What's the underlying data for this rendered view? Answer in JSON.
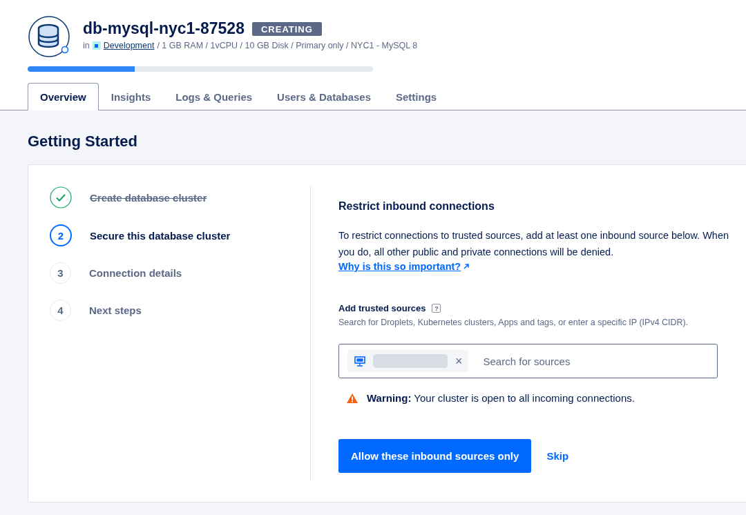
{
  "header": {
    "title": "db-mysql-nyc1-87528",
    "status": "CREATING",
    "meta_prefix": "in",
    "project": "Development",
    "meta": "/ 1 GB RAM / 1vCPU / 10 GB Disk / Primary only / NYC1 - MySQL 8",
    "progress": {
      "level": 0.31
    }
  },
  "tabs": [
    {
      "label": "Overview",
      "selected": true
    },
    {
      "label": "Insights",
      "selected": false
    },
    {
      "label": "Logs & Queries",
      "selected": false
    },
    {
      "label": "Users & Databases",
      "selected": false
    },
    {
      "label": "Settings",
      "selected": false
    }
  ],
  "section_title": "Getting Started",
  "steps": [
    {
      "kind": "done",
      "label": "Create database cluster"
    },
    {
      "kind": "current",
      "number": "2",
      "label": "Secure this database cluster"
    },
    {
      "kind": "pending",
      "number": "3",
      "label": "Connection details"
    },
    {
      "kind": "pending",
      "number": "4",
      "label": "Next steps"
    }
  ],
  "panel": {
    "title": "Restrict inbound connections",
    "description": "To restrict connections to trusted sources, add at least one inbound source below. When you do, all other public and private connections will be denied.",
    "link": "Why is this so important?",
    "field_label": "Add trusted sources",
    "help": "?",
    "hint": "Search for Droplets, Kubernetes clusters, Apps and tags, or enter a specific IP (IPv4 CIDR).",
    "remove": "×",
    "placeholder": "Search for sources",
    "warning": "**Warning:** Your cluster is open to all incoming connections.",
    "primary_button": "Allow these inbound sources only",
    "secondary_button": "Skip"
  }
}
